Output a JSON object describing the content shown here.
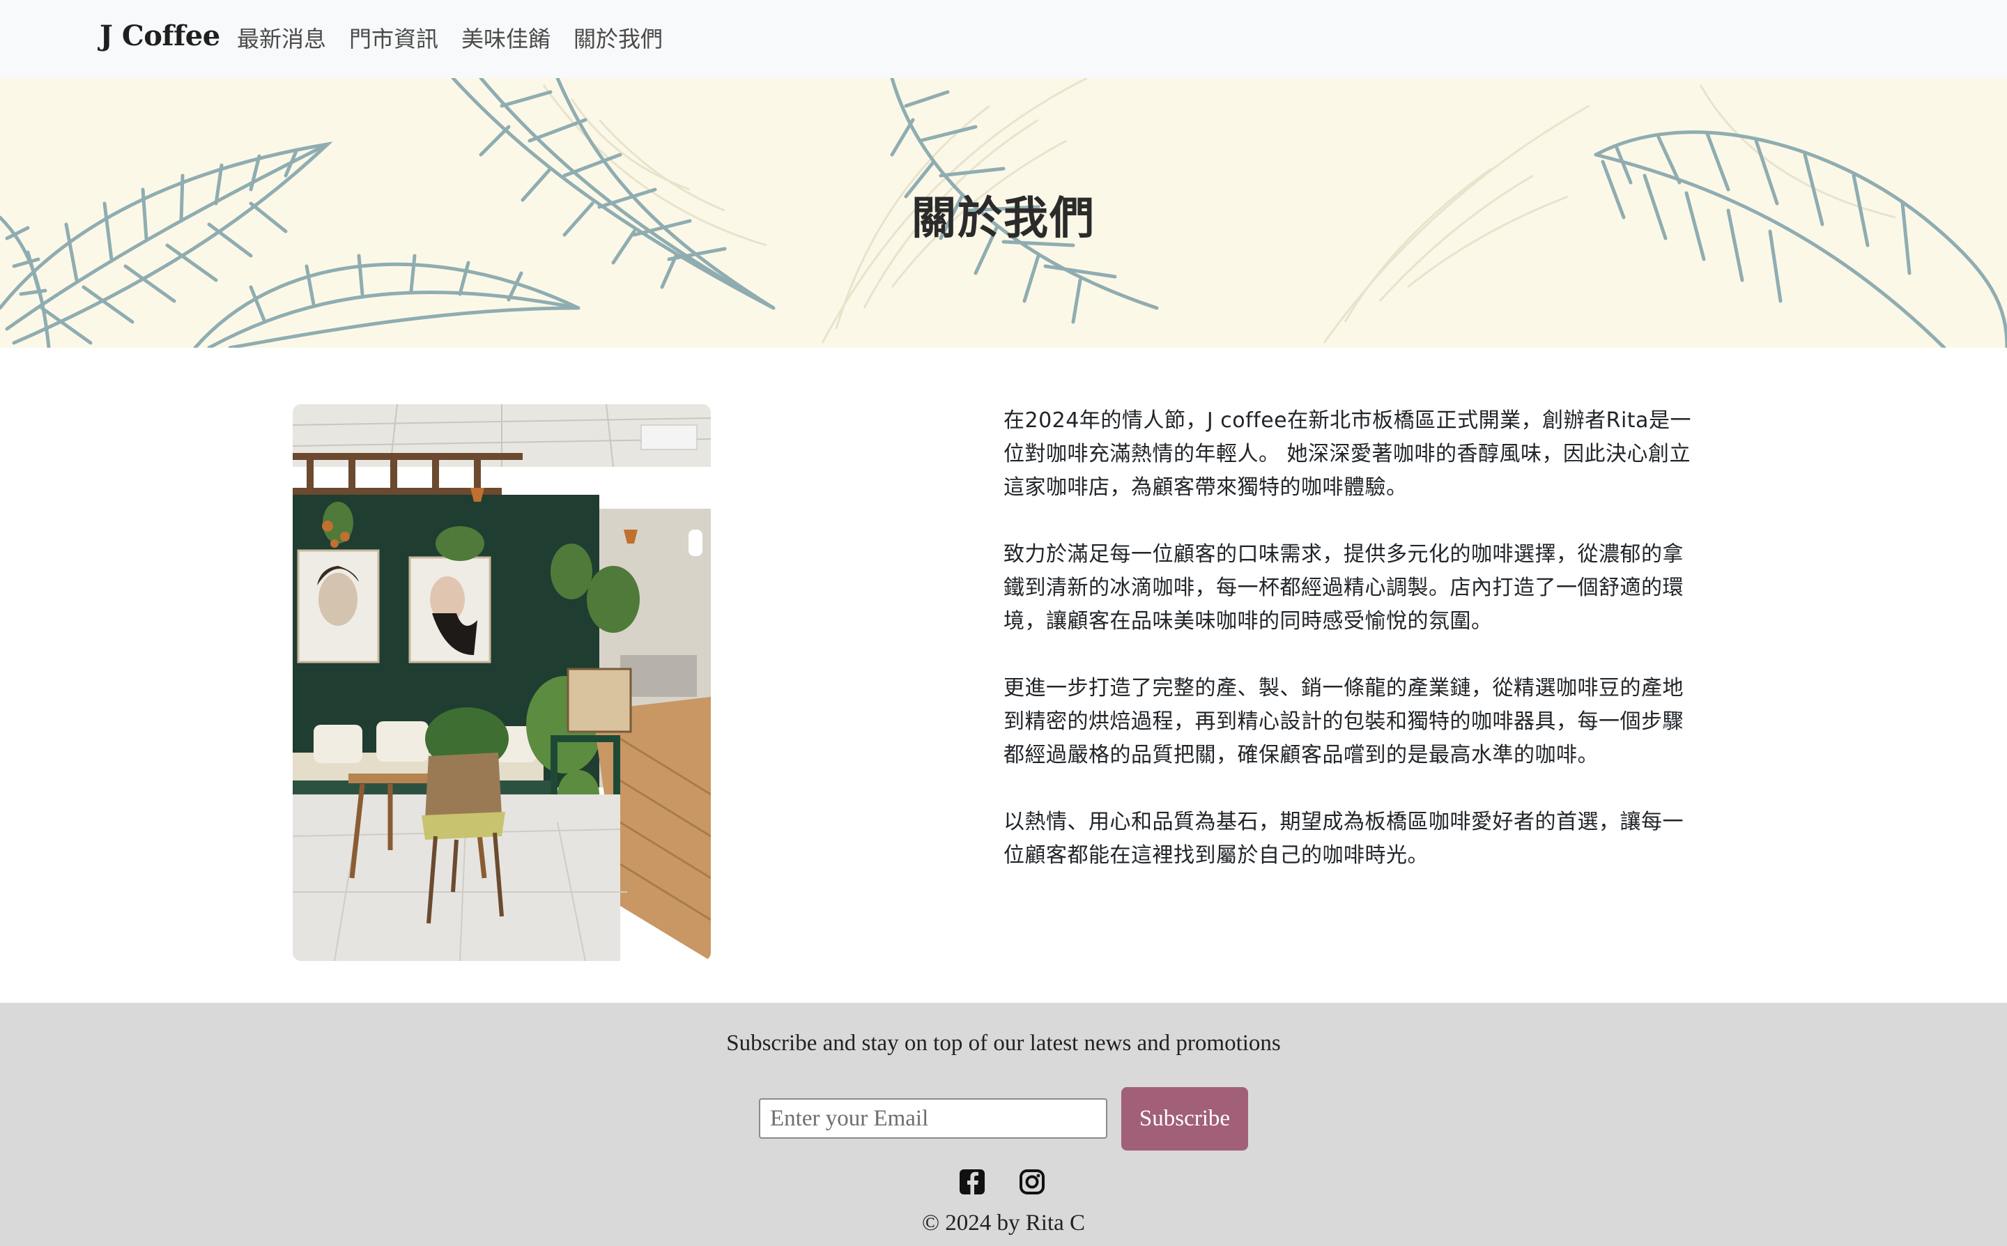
{
  "navbar": {
    "brand": "J Coffee",
    "links": [
      "最新消息",
      "門市資訊",
      "美味佳餚",
      "關於我們"
    ]
  },
  "banner": {
    "title": "關於我們"
  },
  "about": {
    "paragraphs": [
      "在2024年的情人節，J coffee在新北市板橋區正式開業，創辦者Rita是一位對咖啡充滿熱情的年輕人。 她深深愛著咖啡的香醇風味，因此決心創立這家咖啡店，為顧客帶來獨特的咖啡體驗。",
      "致力於滿足每一位顧客的口味需求，提供多元化的咖啡選擇，從濃郁的拿鐵到清新的冰滴咖啡，每一杯都經過精心調製。店內打造了一個舒適的環境，讓顧客在品味美味咖啡的同時感受愉悅的氛圍。",
      "更進一步打造了完整的產、製、銷一條龍的產業鏈，從精選咖啡豆的產地到精密的烘焙過程，再到精心設計的包裝和獨特的咖啡器具，每一個步驟都經過嚴格的品質把關，確保顧客品嚐到的是最高水準的咖啡。",
      "以熱情、用心和品質為基石，期望成為板橋區咖啡愛好者的首選，讓每一位顧客都能在這裡找到屬於自己的咖啡時光。"
    ]
  },
  "footer": {
    "subscribe_text": "Subscribe and stay on top of our latest news and promotions",
    "email_placeholder": "Enter your Email",
    "subscribe_button": "Subscribe",
    "social_icons": [
      "facebook-icon",
      "instagram-icon"
    ],
    "copyright": "© 2024 by Rita C"
  },
  "colors": {
    "navbar_bg": "#f8f9fa",
    "banner_bg": "#fcf8e8",
    "leaf_stroke": "#8fadb1",
    "footer_bg": "#d9d9d9",
    "subscribe_button": "#a15f78"
  }
}
